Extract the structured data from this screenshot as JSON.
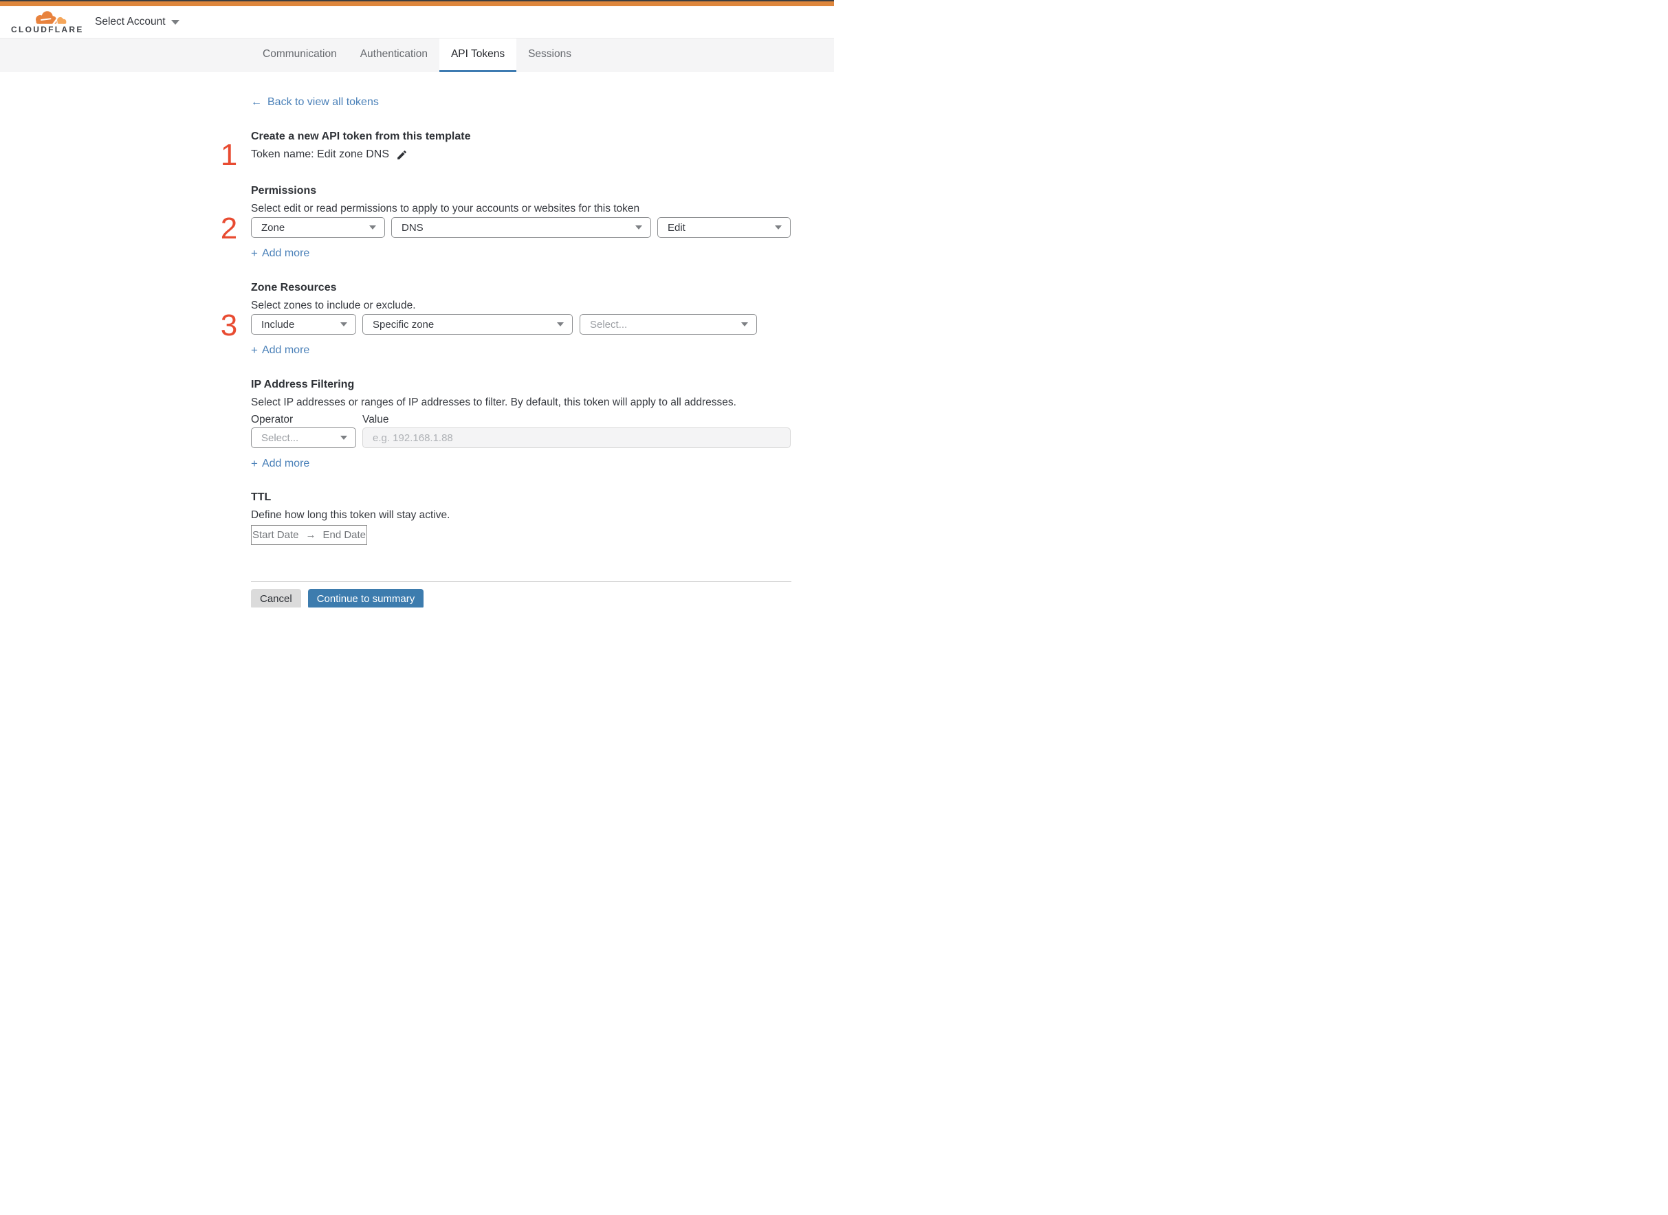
{
  "header": {
    "logo_text": "CLOUDFLARE",
    "account_selector_label": "Select Account"
  },
  "tabs": {
    "items": [
      {
        "label": "Communication",
        "active": false
      },
      {
        "label": "Authentication",
        "active": false
      },
      {
        "label": "API Tokens",
        "active": true
      },
      {
        "label": "Sessions",
        "active": false
      }
    ]
  },
  "back_link": {
    "label": "Back to view all tokens"
  },
  "icons": {
    "back_arrow": "←",
    "date_range_arrow": "→",
    "add_more_plus": "+"
  },
  "token_section": {
    "step": "1",
    "title": "Create a new API token from this template",
    "token_name_line": "Token name: Edit zone DNS"
  },
  "permissions": {
    "step": "2",
    "title": "Permissions",
    "description": "Select edit or read permissions to apply to your accounts or websites for this token",
    "selects": [
      {
        "name": "permission-group",
        "value": "Zone"
      },
      {
        "name": "permission-resource",
        "value": "DNS"
      },
      {
        "name": "permission-access-level",
        "value": "Edit"
      }
    ],
    "add_more_label": "Add more"
  },
  "zone_resources": {
    "step": "3",
    "title": "Zone Resources",
    "description": "Select zones to include or exclude.",
    "selects": [
      {
        "name": "include-exclude",
        "value": "Include"
      },
      {
        "name": "zone-scope",
        "value": "Specific zone"
      },
      {
        "name": "zone-picker",
        "value": "Select...",
        "is_placeholder": true
      }
    ],
    "add_more_label": "Add more"
  },
  "ip_filtering": {
    "title": "IP Address Filtering",
    "description": "Select IP addresses or ranges of IP addresses to filter. By default, this token will apply to all addresses.",
    "operator_label": "Operator",
    "value_label": "Value",
    "operator_select_value": "Select...",
    "value_placeholder": "e.g. 192.168.1.88",
    "add_more_label": "Add more"
  },
  "ttl": {
    "title": "TTL",
    "description": "Define how long this token will stay active.",
    "start_date_label": "Start Date",
    "end_date_label": "End Date"
  },
  "footer": {
    "cancel_label": "Cancel",
    "continue_label": "Continue to summary"
  },
  "colors": {
    "topbar_orange": "#de863c",
    "brand_cloud_orange": "#e8823d",
    "brand_cloud_light": "#f5a65a",
    "accent_blue": "#3d7cae",
    "link_blue": "#4a80b8",
    "step_number_red": "#e84b31",
    "tabstrip_gray": "#f5f5f6"
  }
}
